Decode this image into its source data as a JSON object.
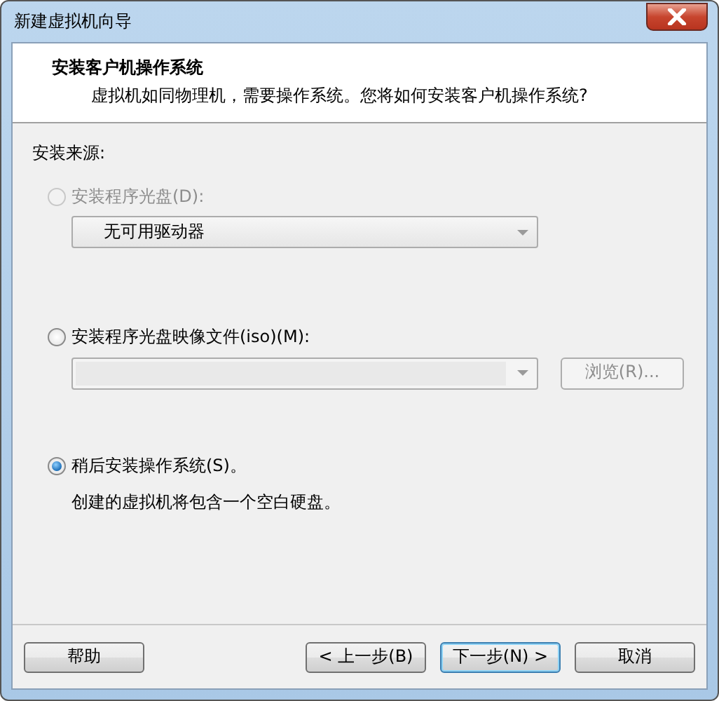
{
  "window": {
    "title": "新建虚拟机向导"
  },
  "header": {
    "title": "安装客户机操作系统",
    "subtitle": "虚拟机如同物理机，需要操作系统。您将如何安装客户机操作系统?"
  },
  "source_label": "安装来源:",
  "options": [
    {
      "kind": "disc",
      "label": "安装程序光盘(D):",
      "selected": false,
      "disabled": true,
      "combo": {
        "value": "无可用驱动器",
        "disabled": false
      }
    },
    {
      "kind": "iso",
      "label": "安装程序光盘映像文件(iso)(M):",
      "selected": false,
      "disabled": false,
      "combo": {
        "disabled": true
      },
      "browse": {
        "label": "浏览(R)...",
        "disabled": true
      }
    },
    {
      "kind": "later",
      "label": "稍后安装操作系统(S)。",
      "selected": true,
      "disabled": false,
      "description": "创建的虚拟机将包含一个空白硬盘。"
    }
  ],
  "buttons": [
    {
      "label": "帮助",
      "default": false
    },
    {
      "label": "< 上一步(B)",
      "default": false
    },
    {
      "label": "下一步(N) >",
      "default": true
    },
    {
      "label": "取消",
      "default": false
    }
  ]
}
